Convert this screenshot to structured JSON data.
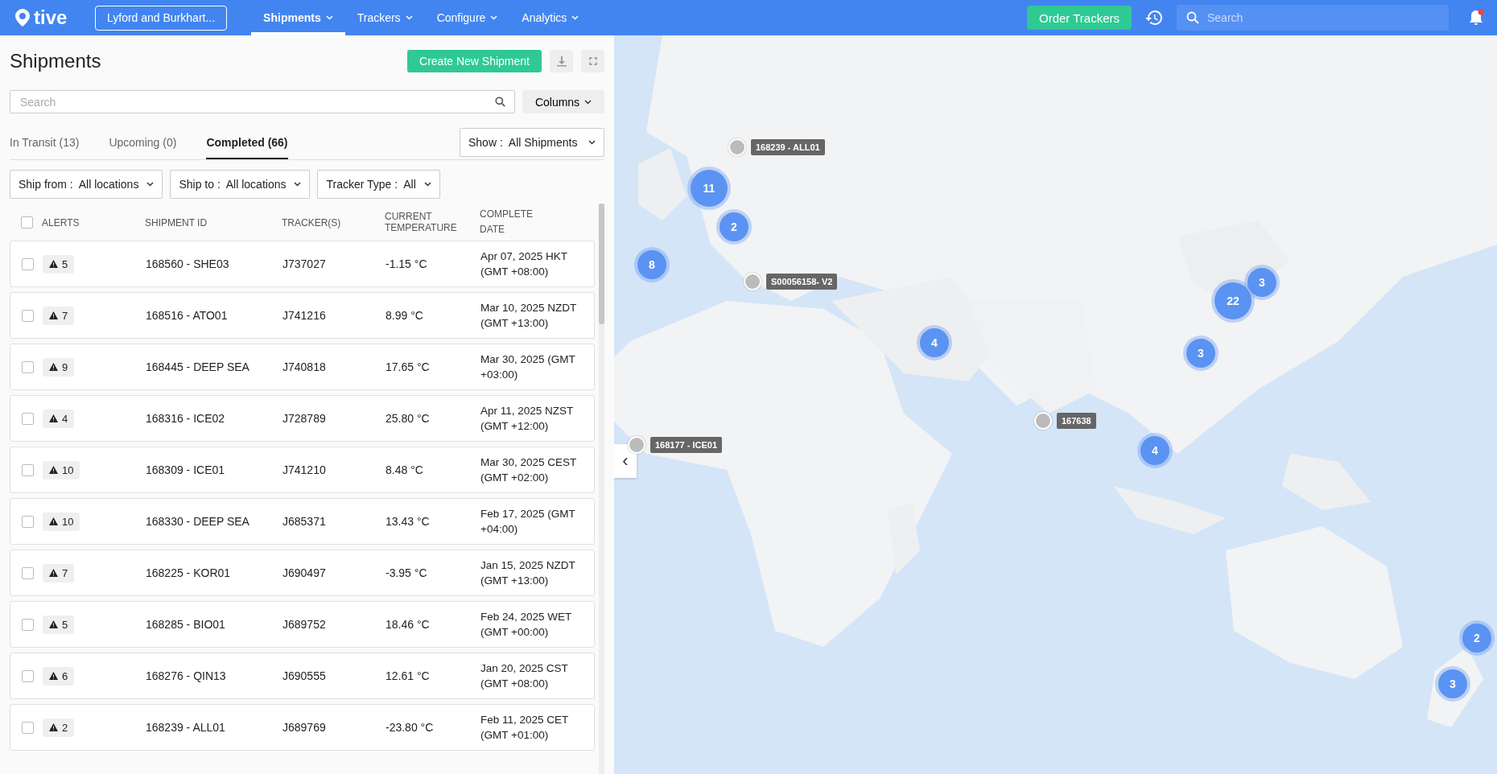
{
  "nav": {
    "logo": "tive",
    "account": "Lyford and Burkhart...",
    "menus": [
      {
        "label": "Shipments",
        "selected": true
      },
      {
        "label": "Trackers",
        "selected": false
      },
      {
        "label": "Configure",
        "selected": false
      },
      {
        "label": "Analytics",
        "selected": false
      }
    ],
    "order_button": "Order Trackers",
    "search": {
      "placeholder": "Search"
    },
    "notifications": {
      "unread": true
    }
  },
  "panel": {
    "title": "Shipments",
    "create_button": "Create New Shipment",
    "search": {
      "placeholder": "Search"
    },
    "columns_button": "Columns",
    "tabs": [
      {
        "label": "In Transit (13)",
        "selected": false
      },
      {
        "label": "Upcoming (0)",
        "selected": false
      },
      {
        "label": "Completed (66)",
        "selected": true
      }
    ],
    "show_filter": {
      "label": "Show :",
      "value": "All Shipments"
    },
    "filters": [
      {
        "label": "Ship from :",
        "value": "All locations"
      },
      {
        "label": "Ship to :",
        "value": "All locations"
      },
      {
        "label": "Tracker Type :",
        "value": "All"
      }
    ],
    "table": {
      "select_all": {
        "checked": false
      },
      "columns": [
        "ALERTS",
        "SHIPMENT ID",
        "TRACKER(S)",
        "CURRENT TEMPERATURE",
        "COMPLETE DATE"
      ],
      "rows": [
        {
          "checked": false,
          "alerts": "5",
          "id": "168560 - SHE03",
          "tracker": "J737027",
          "temperature": "-1.15 °C",
          "date": "Apr 07, 2025 HKT (GMT +08:00)"
        },
        {
          "checked": false,
          "alerts": "7",
          "id": "168516 - ATO01",
          "tracker": "J741216",
          "temperature": "8.99 °C",
          "date": "Mar 10, 2025 NZDT (GMT +13:00)"
        },
        {
          "checked": false,
          "alerts": "9",
          "id": "168445 - DEEP SEA",
          "tracker": "J740818",
          "temperature": "17.65 °C",
          "date": "Mar 30, 2025 (GMT +03:00)"
        },
        {
          "checked": false,
          "alerts": "4",
          "id": "168316 - ICE02",
          "tracker": "J728789",
          "temperature": "25.80 °C",
          "date": "Apr 11, 2025 NZST (GMT +12:00)"
        },
        {
          "checked": false,
          "alerts": "10",
          "id": "168309 - ICE01",
          "tracker": "J741210",
          "temperature": "8.48 °C",
          "date": "Mar 30, 2025 CEST (GMT +02:00)"
        },
        {
          "checked": false,
          "alerts": "10",
          "id": "168330 - DEEP SEA",
          "tracker": "J685371",
          "temperature": "13.43 °C",
          "date": "Feb 17, 2025 (GMT +04:00)"
        },
        {
          "checked": false,
          "alerts": "7",
          "id": "168225 - KOR01",
          "tracker": "J690497",
          "temperature": "-3.95 °C",
          "date": "Jan 15, 2025 NZDT (GMT +13:00)"
        },
        {
          "checked": false,
          "alerts": "5",
          "id": "168285 - BIO01",
          "tracker": "J689752",
          "temperature": "18.46 °C",
          "date": "Feb 24, 2025 WET (GMT +00:00)"
        },
        {
          "checked": false,
          "alerts": "6",
          "id": "168276 - QIN13",
          "tracker": "J690555",
          "temperature": "12.61 °C",
          "date": "Jan 20, 2025 CST (GMT +08:00)"
        },
        {
          "checked": false,
          "alerts": "2",
          "id": "168239 - ALL01",
          "tracker": "J689769",
          "temperature": "-23.80 °C",
          "date": "Feb 11, 2025 CET (GMT +01:00)"
        }
      ]
    }
  },
  "map": {
    "kind": "picture",
    "collapse_button": "‹",
    "markers": [
      {
        "kind": "pin",
        "label": "168239 - ALL01"
      },
      {
        "kind": "pin",
        "label": "S00056158- V2"
      },
      {
        "kind": "pin",
        "label": "167638"
      },
      {
        "kind": "pin",
        "label": "168177 - ICE01"
      },
      {
        "kind": "cluster",
        "label": "11"
      },
      {
        "kind": "cluster",
        "label": "2"
      },
      {
        "kind": "cluster",
        "label": "8"
      },
      {
        "kind": "cluster",
        "label": "4"
      },
      {
        "kind": "cluster",
        "label": "22"
      },
      {
        "kind": "cluster",
        "label": "3"
      },
      {
        "kind": "cluster",
        "label": "3"
      },
      {
        "kind": "cluster",
        "label": "4"
      },
      {
        "kind": "cluster",
        "label": "2"
      },
      {
        "kind": "cluster",
        "label": "3"
      }
    ]
  }
}
